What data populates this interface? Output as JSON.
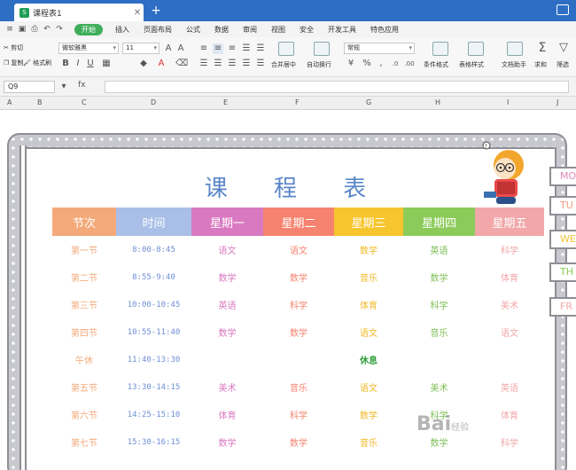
{
  "window": {
    "tab_title": "课程表1",
    "add_tab": "+"
  },
  "menu": {
    "start": "开始",
    "items": [
      "插入",
      "页面布局",
      "公式",
      "数据",
      "审阅",
      "视图",
      "安全",
      "开发工具",
      "特色应用"
    ]
  },
  "ribbon": {
    "cut": "剪切",
    "copy": "复制",
    "format_painter": "格式刷",
    "font_name": "微软雅黑",
    "font_size": "11",
    "merge_center": "合并居中",
    "wrap": "自动换行",
    "number_format": "常规",
    "cond_format": "条件格式",
    "table_style": "表格样式",
    "doc_helper": "文档助手",
    "sum": "求和",
    "filter": "筛选"
  },
  "formula_bar": {
    "name_box": "Q9",
    "fx": "fx",
    "value": ""
  },
  "columns": [
    "A",
    "B",
    "C",
    "D",
    "E",
    "F",
    "G",
    "H",
    "I",
    "J"
  ],
  "schedule": {
    "title": "课 程 表",
    "headers": [
      "节次",
      "时间",
      "星期一",
      "星期二",
      "星期三",
      "星期四",
      "星期五"
    ],
    "header_colors": [
      "#f4a97a",
      "#a9bfe8",
      "#d979c1",
      "#f6836f",
      "#f7c52e",
      "#8ccb5a",
      "#f2a7a9"
    ],
    "rows": [
      {
        "period": "第一节",
        "time": "8:00-8:45",
        "days": [
          "语文",
          "语文",
          "数学",
          "英语",
          "科学"
        ]
      },
      {
        "period": "第二节",
        "time": "8:55-9:40",
        "days": [
          "数学",
          "数学",
          "音乐",
          "数学",
          "体育"
        ]
      },
      {
        "period": "第三节",
        "time": "10:00-10:45",
        "days": [
          "英语",
          "科学",
          "体育",
          "科学",
          "美术"
        ]
      },
      {
        "period": "第四节",
        "time": "10:55-11:40",
        "days": [
          "数学",
          "数学",
          "语文",
          "音乐",
          "语文"
        ]
      },
      {
        "period": "午休",
        "time": "11:40-13:30",
        "days": [
          "",
          "",
          "休息",
          "",
          ""
        ]
      },
      {
        "period": "第五节",
        "time": "13:30-14:15",
        "days": [
          "美术",
          "音乐",
          "语文",
          "美术",
          "英语"
        ]
      },
      {
        "period": "第六节",
        "time": "14:25-15:10",
        "days": [
          "体育",
          "科学",
          "数学",
          "科学",
          "体育"
        ]
      },
      {
        "period": "第七节",
        "time": "15:30-16:15",
        "days": [
          "数学",
          "数学",
          "音乐",
          "数学",
          "科学"
        ]
      }
    ],
    "day_colors": [
      "#d979c1",
      "#f6836f",
      "#f2b927",
      "#7fbf55",
      "#f2a7a9"
    ],
    "period_color": "#f4a97a",
    "rest_color": "#2f9e3a"
  },
  "side_tabs": [
    {
      "label": "MO",
      "color": "#e08ab8"
    },
    {
      "label": "TU",
      "color": "#f29a7c"
    },
    {
      "label": "WE",
      "color": "#f2c230"
    },
    {
      "label": "TH",
      "color": "#8ccb5a"
    },
    {
      "label": "FR",
      "color": "#f2a7a9"
    }
  ],
  "watermark": {
    "main": "Bai",
    "sub": "经验"
  }
}
